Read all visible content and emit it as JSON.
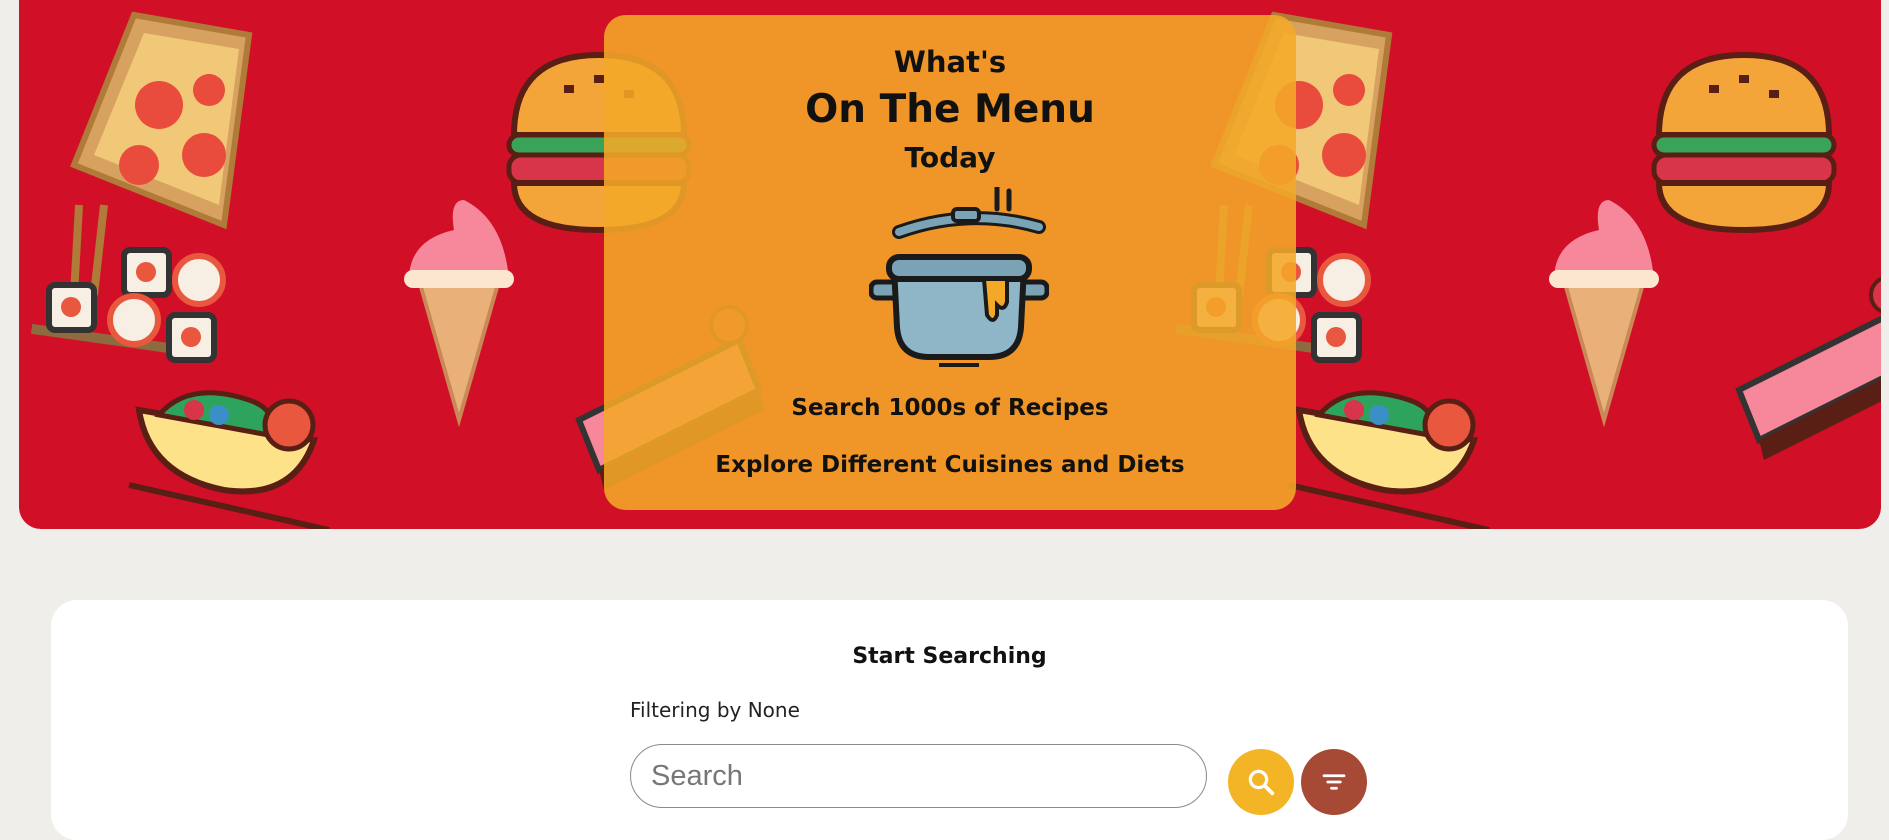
{
  "hero": {
    "line1": "What's",
    "line2": "On The Menu",
    "line3": "Today",
    "subtitle1": "Search 1000s of Recipes",
    "subtitle2": "Explore Different Cuisines and Diets",
    "colors": {
      "background": "#d10f27",
      "overlay": "#f4a828"
    },
    "icons": [
      "pizza-icon",
      "burger-icon",
      "sushi-icon",
      "ice-cream-icon",
      "salad-icon",
      "cake-icon",
      "cooking-pot-icon"
    ]
  },
  "search": {
    "title": "Start Searching",
    "filter_label": "Filtering by None",
    "placeholder": "Search",
    "value": "",
    "search_button_icon": "magnifier-icon",
    "filter_button_icon": "filter-icon",
    "colors": {
      "search_button": "#f3b526",
      "filter_button": "#a64a36",
      "page_background": "#efeeea"
    }
  }
}
